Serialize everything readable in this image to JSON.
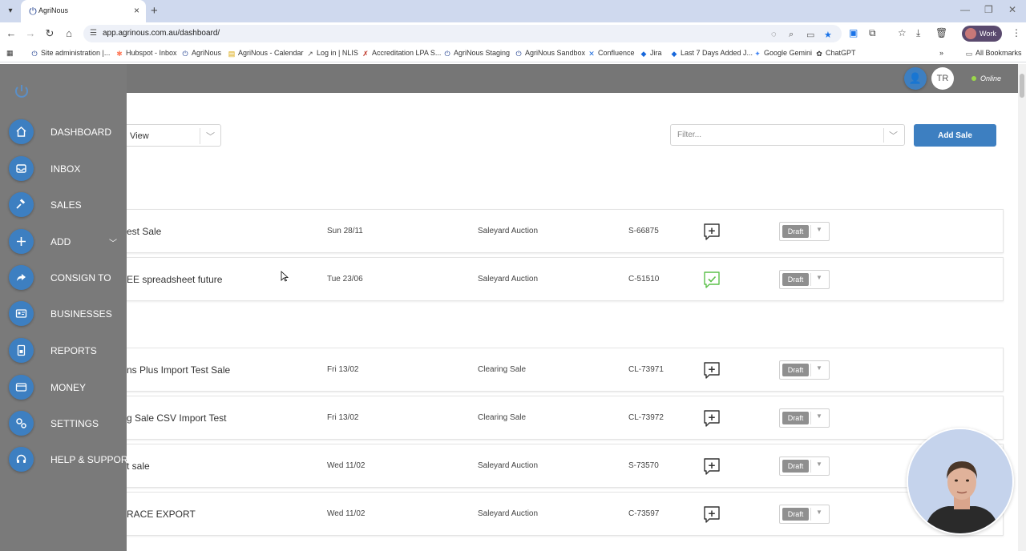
{
  "browser": {
    "tab_title": "AgriNous",
    "url": "app.agrinous.com.au/dashboard/",
    "profile_label": "Work",
    "bookmarks": [
      "Site administration |...",
      "Hubspot - Inbox",
      "AgriNous",
      "AgriNous - Calendar",
      "Log in | NLIS",
      "Accreditation LPA S...",
      "AgriNous Staging",
      "AgriNous Sandbox",
      "Confluence",
      "Jira",
      "Last 7 Days Added J...",
      "Google Gemini",
      "ChatGPT"
    ],
    "all_bookmarks": "All Bookmarks"
  },
  "header": {
    "user_initials": "TR",
    "status": "Online"
  },
  "sidebar": {
    "items": [
      {
        "label": "DASHBOARD",
        "icon": "home-icon"
      },
      {
        "label": "INBOX",
        "icon": "inbox-icon"
      },
      {
        "label": "SALES",
        "icon": "gavel-icon"
      },
      {
        "label": "ADD",
        "icon": "plus-icon"
      },
      {
        "label": "CONSIGN TO",
        "icon": "share-icon"
      },
      {
        "label": "BUSINESSES",
        "icon": "id-card-icon"
      },
      {
        "label": "REPORTS",
        "icon": "report-icon"
      },
      {
        "label": "MONEY",
        "icon": "wallet-icon"
      },
      {
        "label": "SETTINGS",
        "icon": "gears-icon"
      },
      {
        "label": "HELP & SUPPORT",
        "icon": "headset-icon"
      }
    ]
  },
  "toolbar": {
    "view_label": "View",
    "filter_placeholder": "Filter...",
    "add_sale_label": "Add Sale"
  },
  "sales": [
    {
      "name": "est Sale",
      "date": "Sun 28/11",
      "type": "Saleyard Auction",
      "code": "S-66875",
      "status": "Draft",
      "checked": false
    },
    {
      "name": "EE spreadsheet future",
      "date": "Tue 23/06",
      "type": "Saleyard Auction",
      "code": "C-51510",
      "status": "Draft",
      "checked": true
    },
    {
      "name": "ns Plus Import Test Sale",
      "date": "Fri 13/02",
      "type": "Clearing Sale",
      "code": "CL-73971",
      "status": "Draft",
      "checked": false
    },
    {
      "name": "g Sale CSV Import Test",
      "date": "Fri 13/02",
      "type": "Clearing Sale",
      "code": "CL-73972",
      "status": "Draft",
      "checked": false
    },
    {
      "name": "t sale",
      "date": "Wed 11/02",
      "type": "Saleyard Auction",
      "code": "S-73570",
      "status": "Draft",
      "checked": false
    },
    {
      "name": "RACE EXPORT",
      "date": "Wed 11/02",
      "type": "Saleyard Auction",
      "code": "C-73597",
      "status": "Draft",
      "checked": false
    }
  ],
  "colors": {
    "accent": "#3d7fc1",
    "sidebar": "#7a7a7a",
    "header": "#767676",
    "draft_badge": "#8f8f8f",
    "comment_checked": "#5cc04a"
  }
}
